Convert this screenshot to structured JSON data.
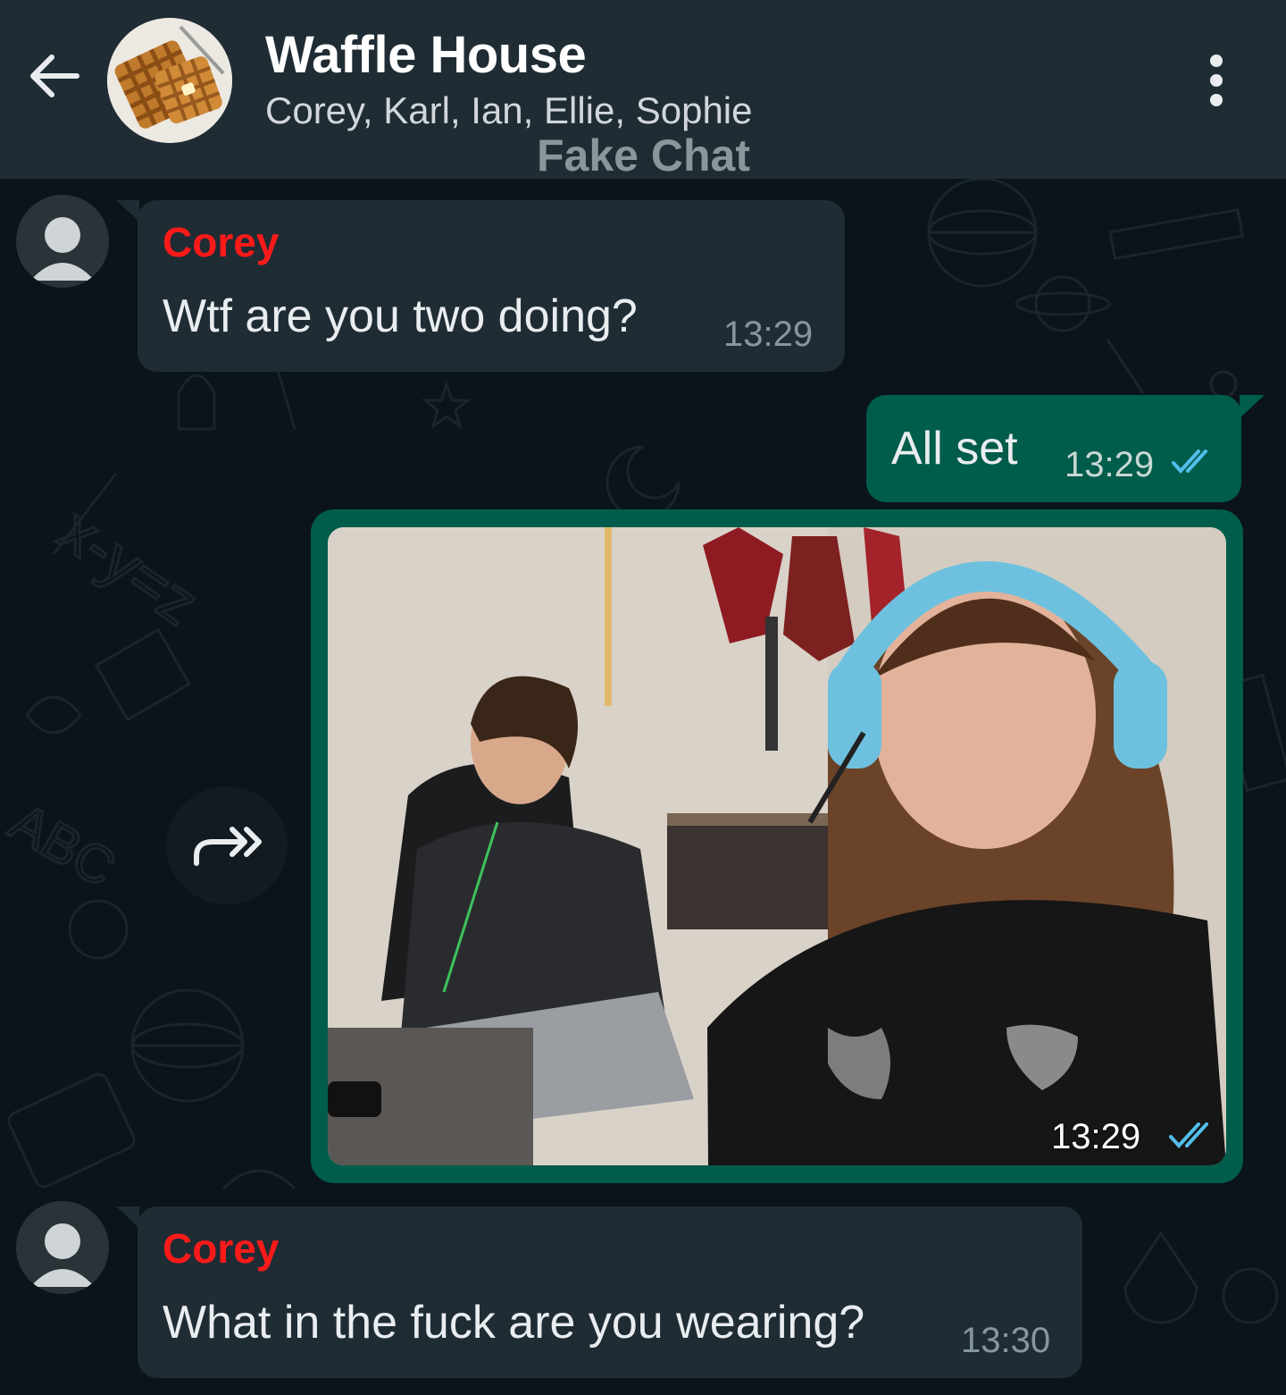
{
  "header": {
    "title": "Waffle House",
    "participants": "Corey, Karl, Ian, Ellie, Sophie",
    "watermark": "Fake Chat"
  },
  "messages": [
    {
      "direction": "incoming",
      "sender": "Corey",
      "text": "Wtf are you two doing?",
      "time": "13:29"
    },
    {
      "direction": "outgoing",
      "text": "All set",
      "time": "13:29",
      "status": "read"
    },
    {
      "direction": "outgoing",
      "type": "image",
      "time": "13:29",
      "status": "read"
    },
    {
      "direction": "incoming",
      "sender": "Corey",
      "text": "What in the fuck are you wearing?",
      "time": "13:30"
    }
  ],
  "colors": {
    "header_bg": "#1f2c34",
    "chat_bg": "#0b141a",
    "incoming_bubble": "#1f2c34",
    "outgoing_bubble": "#005c4b",
    "sender_name": "#ff1a1a",
    "read_ticks": "#53bdeb"
  },
  "icons": {
    "back": "arrow-left-icon",
    "menu": "kebab-menu-icon",
    "forward": "forward-icon",
    "read": "double-check-icon"
  }
}
